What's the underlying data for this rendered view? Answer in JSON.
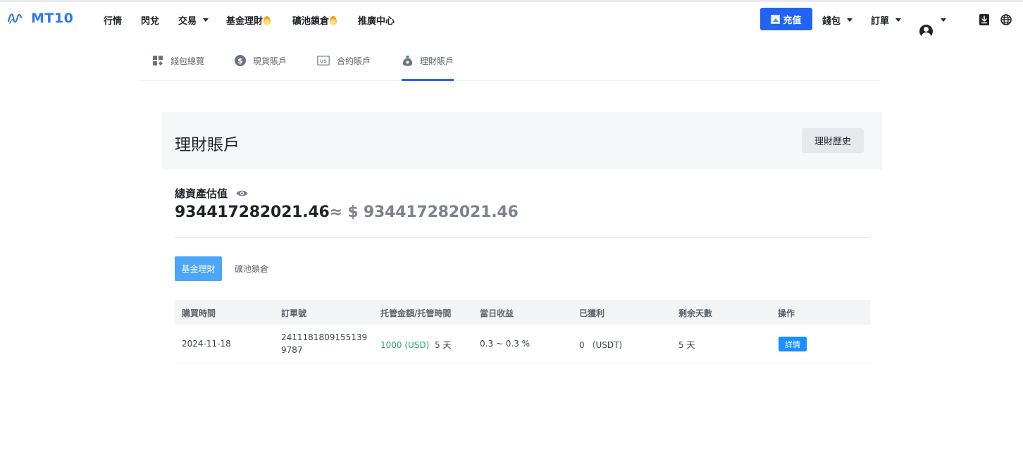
{
  "app": {
    "brand": "MT10"
  },
  "nav": {
    "items": [
      {
        "label": "行情"
      },
      {
        "label": "閃兌"
      },
      {
        "label": "交易"
      },
      {
        "label": "基金理財"
      },
      {
        "label": "礦池鎖倉"
      },
      {
        "label": "推廣中心"
      }
    ],
    "recharge_label": "充值",
    "wallet_label": "錢包",
    "orders_label": "訂單"
  },
  "account_tabs": [
    {
      "label": "錢包總覽",
      "icon": "dashboard-icon"
    },
    {
      "label": "現貨賬戶",
      "icon": "dollar-coin-icon"
    },
    {
      "label": "合約賬戶",
      "icon": "usd-card-icon"
    },
    {
      "label": "理財賬戶",
      "icon": "finance-bag-icon",
      "active": true
    }
  ],
  "panel": {
    "title": "理財賬戶",
    "history_button": "理財歷史"
  },
  "summary": {
    "label": "總資產估值",
    "value": "934417282021.46",
    "approx_value": "≈ $ 934417282021.46"
  },
  "sub_tabs": [
    {
      "label": "基金理財",
      "active": true
    },
    {
      "label": "礦池鎖倉",
      "active": false
    }
  ],
  "table": {
    "headers": [
      "購買時間",
      "訂單號",
      "托管金額/托管時間",
      "當日收益",
      "已獲利",
      "剩余天數",
      "操作"
    ],
    "rows": [
      {
        "purchase_time": "2024-11-18",
        "order_no": "24111818091551399787",
        "amount": "1000 (USD)",
        "duration": "5 天",
        "daily_yield": "0.3 ~ 0.3 %",
        "profit": "0 （USDT)",
        "remaining_days": "5 天",
        "action": "詳情"
      }
    ]
  },
  "colors": {
    "accent": "#2263f5",
    "brand": "#2e7be8",
    "active_sub_tab": "#4da5f7",
    "detail_button": "#1b8ffb",
    "amount_green": "#27a56b"
  }
}
